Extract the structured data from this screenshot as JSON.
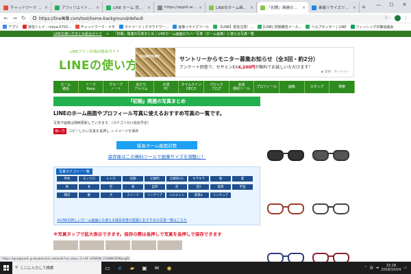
{
  "tabs": [
    {
      "label": "チャットワーク - [aozora]",
      "color": "#e74c3c",
      "active": false
    },
    {
      "label": "アフィリエイト的自分発見",
      "color": "#27ae60",
      "active": false
    },
    {
      "label": "LINE ホーム 背景画像",
      "color": "#27ae60",
      "active": false
    },
    {
      "label": "https://applii-world.com",
      "color": "#888888",
      "active": false
    },
    {
      "label": "LINEのホーム画面の背景",
      "color": "#8bc34a",
      "active": false
    },
    {
      "label": "「初期」関連の写真まとめ",
      "color": "#8bc34a",
      "active": true
    },
    {
      "label": "画像リサイズツール",
      "color": "#1e88e5",
      "active": false
    }
  ],
  "window_controls": {
    "minimize": "—",
    "maximize": "☐",
    "close": "✕"
  },
  "address": {
    "url": "https://line画像.com/tool/home-background/default"
  },
  "bookmarks": [
    {
      "label": "アプリ",
      "color": "#4285f4"
    },
    {
      "label": "受信トレイ - miiya.0703...",
      "color": "#d93025"
    },
    {
      "label": "チャットワーク - メモ",
      "color": "#e74c3c"
    },
    {
      "label": "マイページ | クラウドワー...",
      "color": "#1e88e5"
    },
    {
      "label": "画像リサイズツール",
      "color": "#1e88e5"
    },
    {
      "label": "【LINE】緊急注意！...",
      "color": "#27ae60"
    },
    {
      "label": "[LINE] 問題報告メール...",
      "color": "#27ae60"
    },
    {
      "label": "ヘルプセンター | LINE",
      "color": "#27ae60"
    },
    {
      "label": "フィッシング対策協議会",
      "color": "#0f9d58"
    }
  ],
  "breadcrumb": {
    "home": "LINEの使い方まとめ総合ガイド",
    "current": "「初期」関連の写真まとめ | LINEホーム画面のカバー写真（ホーム画像）に使える写真一覧"
  },
  "logo": {
    "tagline": "LINEファンの為の総合ガイド",
    "title": "LINEの使い方"
  },
  "ad_top": {
    "brand": "SUNTORY",
    "headline": "サントリーからモニター募集お知らせ（全3回・約2分）",
    "sub_before": "アンケート回答で、セサミンEX",
    "sub_price": "4,200円",
    "sub_after": "が無料でお試しいただけます！",
    "provider": "▶ 提供：サントリー"
  },
  "gnav": [
    [
      "ホーム",
      "通話"
    ],
    [
      "トーク",
      "Keep"
    ],
    [
      "グループ",
      "ノート"
    ],
    [
      "友だち",
      "アルバム"
    ],
    [
      "お送",
      "PC"
    ],
    [
      "タイムライン",
      "DECO"
    ],
    [
      "ブロック",
      "ブログ"
    ],
    [
      "会員",
      "便利ツール"
    ],
    [
      "プロフィール",
      ""
    ],
    [
      "画像",
      ""
    ],
    [
      "スタンプ",
      ""
    ],
    [
      "検索",
      ""
    ]
  ],
  "main": {
    "title": "『初期』関連の写真まとめ",
    "heading": "LINEのホーム画面やプロフィール写真に使えるおすすめ写真の一覧です。",
    "desc1": "写真や画像は随時更新していきます。（カテゴリ分け追加予定）",
    "tag": "使い方",
    "desc2": "コピーしたい写真を長押し → イメージを保存",
    "button": "縦長ホーム画面対策",
    "tool_link": "保存後はこの無料ツールで画像サイズを調整に！",
    "categories_label": "写真カテゴリー一覧",
    "categories": [
      "単色",
      "モノクロ",
      "レトロ",
      "初期",
      "幻想的",
      "幻想的(2)",
      "キラキラ",
      "春",
      "夏",
      "秋",
      "冬",
      "空",
      "海",
      "自然",
      "花",
      "空2",
      "夜景",
      "宇宙",
      "朝日",
      "動",
      "犬",
      "スイーツ",
      "インテリア",
      "シルエット",
      "夜景&",
      "ミニチュア"
    ],
    "categories_note": "※LINEの新しいホーム画面にも使える縦長背景の壁紙におすすめの写真一覧はこちら",
    "warning": "※写真タップで拡大表示できます。保存の際は長押しで写真を長押しで保存できます"
  },
  "status_url": "https://googleads.g.doubleclick.net/aclk?sa=l&ai=C+AF-cRDQW_CfxNWOEMjIvqJAxxxx",
  "taskbar": {
    "search_placeholder": "ここに入力して検索",
    "time": "15:29",
    "date": "2018/10/24"
  }
}
